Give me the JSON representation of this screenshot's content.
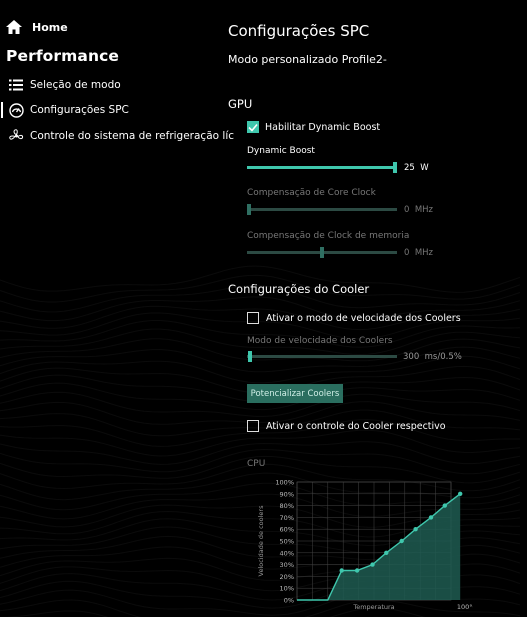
{
  "sidebar": {
    "home_label": "Home",
    "title": "Performance",
    "items": [
      {
        "label": "Seleção de modo",
        "icon": "list-icon"
      },
      {
        "label": "Configurações SPC",
        "icon": "speedometer-icon"
      },
      {
        "label": "Controle do sistema de refrigeração líc",
        "icon": "fan-icon"
      }
    ]
  },
  "main": {
    "title": "Configurações SPC",
    "subtitle": "Modo personalizado Profile2-",
    "gpu": {
      "heading": "GPU",
      "dynamic_boost_checkbox": "Habilitar Dynamic Boost",
      "dynamic_boost_checked": true,
      "dynamic_boost_label": "Dynamic Boost",
      "dynamic_boost_value": "25",
      "dynamic_boost_unit": "W",
      "dynamic_boost_fraction": 1.0,
      "core_clock_label": "Compensação de Core Clock",
      "core_clock_value": "0",
      "core_clock_unit": "MHz",
      "core_clock_fraction": 0.0,
      "mem_clock_label": "Compensação de Clock de memoria",
      "mem_clock_value": "0",
      "mem_clock_unit": "MHz",
      "mem_clock_fraction": 0.5
    },
    "cooler": {
      "heading": "Configurações do Cooler",
      "speed_mode_checkbox": "Ativar o modo de velocidade dos Coolers",
      "speed_mode_checked": false,
      "speed_mode_label": "Modo de velocidade dos Coolers",
      "speed_mode_value": "300",
      "speed_mode_unit": "ms/0.5%",
      "speed_mode_fraction": 0.0,
      "boost_button": "Potencializar Coolers",
      "respective_checkbox": "Ativar o controle do Cooler respectivo",
      "respective_checked": false
    },
    "cpu_label": "CPU"
  },
  "colors": {
    "accent": "#3fc7ad",
    "background": "#000000",
    "chart_fill": "#1f5c51"
  },
  "chart_data": {
    "type": "area",
    "title": "",
    "xlabel": "Temperatura",
    "ylabel": "Velocidade de coolers",
    "x_end_label": "100°C",
    "yticks": [
      "0%",
      "10%",
      "20%",
      "30%",
      "40%",
      "50%",
      "60%",
      "70%",
      "80%",
      "90%",
      "100%"
    ],
    "ylim": [
      0,
      100
    ],
    "xlim": [
      0,
      100
    ],
    "x": [
      0,
      20,
      30,
      40,
      50,
      60,
      70,
      80,
      90
    ],
    "values": [
      0,
      0,
      25,
      25,
      30,
      40,
      50,
      60,
      70,
      80,
      90
    ],
    "points": [
      [
        0,
        0
      ],
      [
        20,
        0
      ],
      [
        29,
        25
      ],
      [
        39,
        25
      ],
      [
        49,
        30
      ],
      [
        58,
        40
      ],
      [
        68,
        50
      ],
      [
        77,
        60
      ],
      [
        87,
        70
      ],
      [
        96,
        80
      ],
      [
        106,
        90
      ]
    ]
  }
}
